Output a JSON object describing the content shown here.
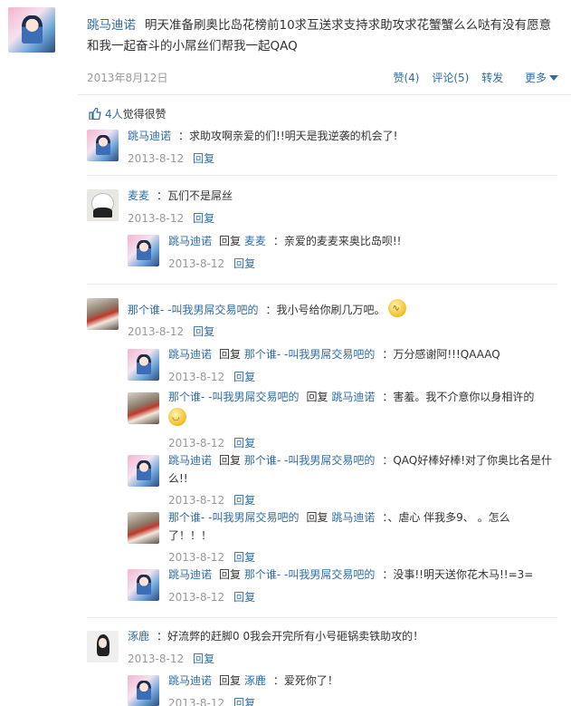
{
  "post": {
    "author": "跳马迪诺",
    "text": "明天准备刷奥比岛花榜前10求互送求支持求助攻求花蟹蟹么么哒有没有愿意和我一起奋斗的小屌丝们帮我一起QAQ",
    "date": "2013年8月12日",
    "actions": {
      "like": "赞(4)",
      "comment": "评论(5)",
      "forward": "转发",
      "more": "更多"
    }
  },
  "likes": {
    "count": "4人",
    "text": "觉得很赞"
  },
  "reply_label": "回复",
  "comments": [
    {
      "id": "c1",
      "author": "跳马迪诺",
      "text": "：求助攻啊亲爱的们!!明天是我逆袭的机会了!",
      "date": "2013-8-12",
      "avatar": "anime-avatar"
    },
    {
      "id": "c2",
      "author": "麦麦",
      "text": "：瓦们不是屌丝",
      "date": "2013-8-12",
      "avatar": "panda-avatar",
      "replies": [
        {
          "author": "跳马迪诺",
          "verb": "回复",
          "target": "麦麦",
          "text": "：亲爱的麦麦来奥比岛呗!!",
          "date": "2013-8-12",
          "avatar": "anime-avatar"
        }
      ]
    },
    {
      "id": "c3",
      "author": "那个谁- -叫我男屌交易吧的",
      "text": "：我小号给你刷几万吧。",
      "date": "2013-8-12",
      "avatar": "crowd-avatar",
      "emoji": "worried-emoji",
      "replies": [
        {
          "author": "跳马迪诺",
          "verb": "回复",
          "target": "那个谁- -叫我男屌交易吧的",
          "text": "：万分感谢阿!!!QAAAQ",
          "date": "2013-8-12",
          "avatar": "anime-avatar"
        },
        {
          "author": "那个谁- -叫我男屌交易吧的",
          "verb": "回复",
          "target": "跳马迪诺",
          "text": "：害羞。我不介意你以身相许的",
          "date": "2013-8-12",
          "avatar": "crowd-avatar",
          "emoji": "shy-emoji"
        },
        {
          "author": "跳马迪诺",
          "verb": "回复",
          "target": "那个谁- -叫我男屌交易吧的",
          "text": "：QAQ好棒好棒!对了你奥比名是什",
          "text2": "么!!",
          "date": "2013-8-12",
          "avatar": "anime-avatar"
        },
        {
          "author": "那个谁- -叫我男屌交易吧的",
          "verb": "回复",
          "target": "跳马迪诺",
          "text": "：、虐心 伴我多9、 。怎么",
          "text2": "了！！！",
          "date": "2013-8-12",
          "avatar": "crowd-avatar"
        },
        {
          "author": "跳马迪诺",
          "verb": "回复",
          "target": "那个谁- -叫我男屌交易吧的",
          "text": "：没事!!明天送你花木马!!=3=",
          "date": "2013-8-12",
          "avatar": "anime-avatar"
        }
      ]
    },
    {
      "id": "c4",
      "author": "涿鹿",
      "text": "：好流弊的赶脚0 0我会开完所有小号砸锅卖铁助攻的！",
      "date": "2013-8-12",
      "avatar": "girl-avatar",
      "replies": [
        {
          "author": "跳马迪诺",
          "verb": "回复",
          "target": "涿鹿",
          "text": "：爱死你了！",
          "date": "2013-8-12",
          "avatar": "anime-avatar"
        }
      ]
    }
  ]
}
